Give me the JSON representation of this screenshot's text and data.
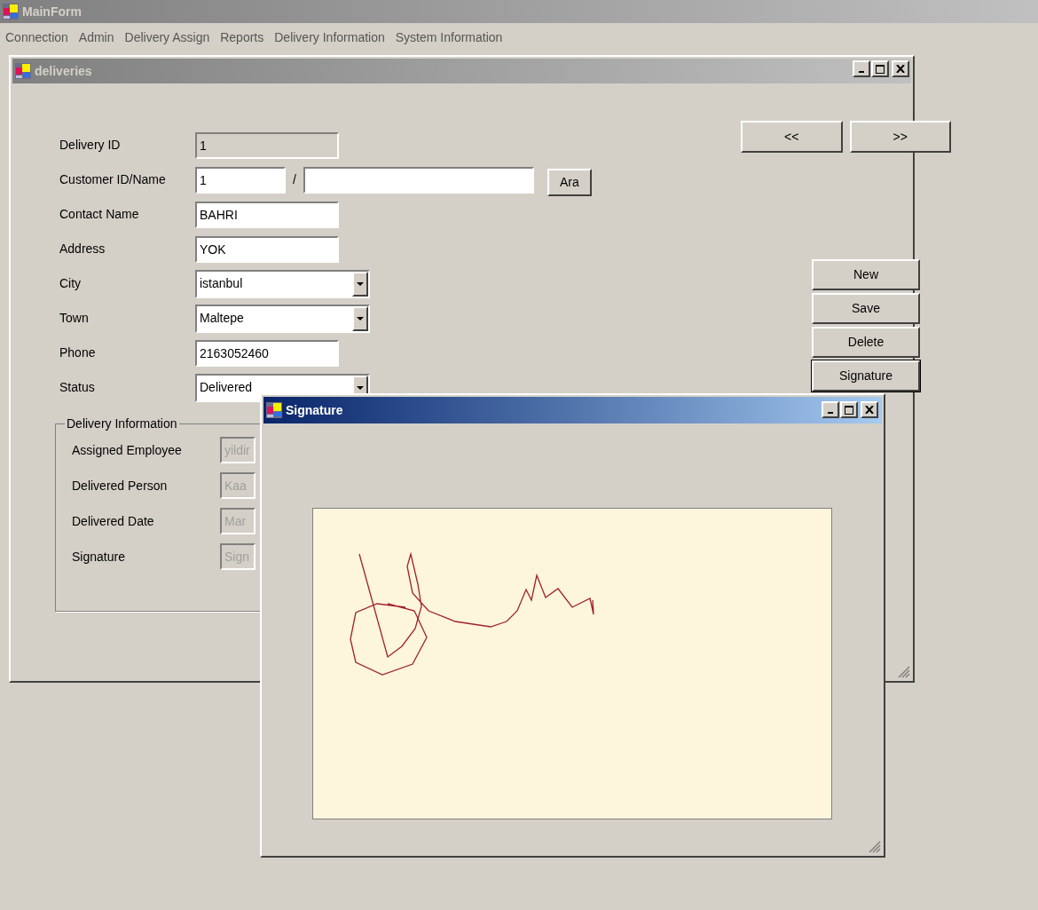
{
  "main_window": {
    "title": "MainForm",
    "active": false
  },
  "menu": [
    "Connection",
    "Admin",
    "Delivery Assign",
    "Reports",
    "Delivery Information",
    "System Information"
  ],
  "deliveries_window": {
    "title": "deliveries",
    "active": false,
    "nav_buttons": [
      "<<",
      ">>"
    ],
    "fields": [
      {
        "label": "Delivery ID",
        "kind": "text",
        "value": "1",
        "readonly": true
      },
      {
        "label": "Customer ID/Name",
        "kind": "customer",
        "value": "1",
        "readonly": false,
        "separator": "/",
        "button": "Ara"
      },
      {
        "label": "Contact Name",
        "kind": "text",
        "value": "BAHRI",
        "readonly": false
      },
      {
        "label": "Address",
        "kind": "text",
        "value": "YOK",
        "readonly": false
      },
      {
        "label": "City",
        "kind": "combo",
        "value": "istanbul",
        "readonly": false
      },
      {
        "label": "Town",
        "kind": "combo",
        "value": "Maltepe",
        "readonly": false
      },
      {
        "label": "Phone",
        "kind": "text",
        "value": "2163052460",
        "readonly": false
      },
      {
        "label": "Status",
        "kind": "combo",
        "value": "Delivered",
        "readonly": false
      }
    ],
    "action_buttons": [
      {
        "label": "New",
        "focused": false
      },
      {
        "label": "Save",
        "focused": false
      },
      {
        "label": "Delete",
        "focused": false
      },
      {
        "label": "Signature",
        "focused": true
      }
    ],
    "group": {
      "title": "Delivery Information",
      "fields": [
        {
          "label": "Assigned Employee",
          "value": "yildir",
          "disabled": true
        },
        {
          "label": "Delivered Person",
          "value": "Kaa",
          "disabled": true
        },
        {
          "label": "Delivered Date",
          "value": "Mar",
          "disabled": true
        },
        {
          "label": "Signature",
          "value": "Sign",
          "disabled": true
        }
      ]
    }
  },
  "signature_window": {
    "title": "Signature",
    "active": true
  }
}
